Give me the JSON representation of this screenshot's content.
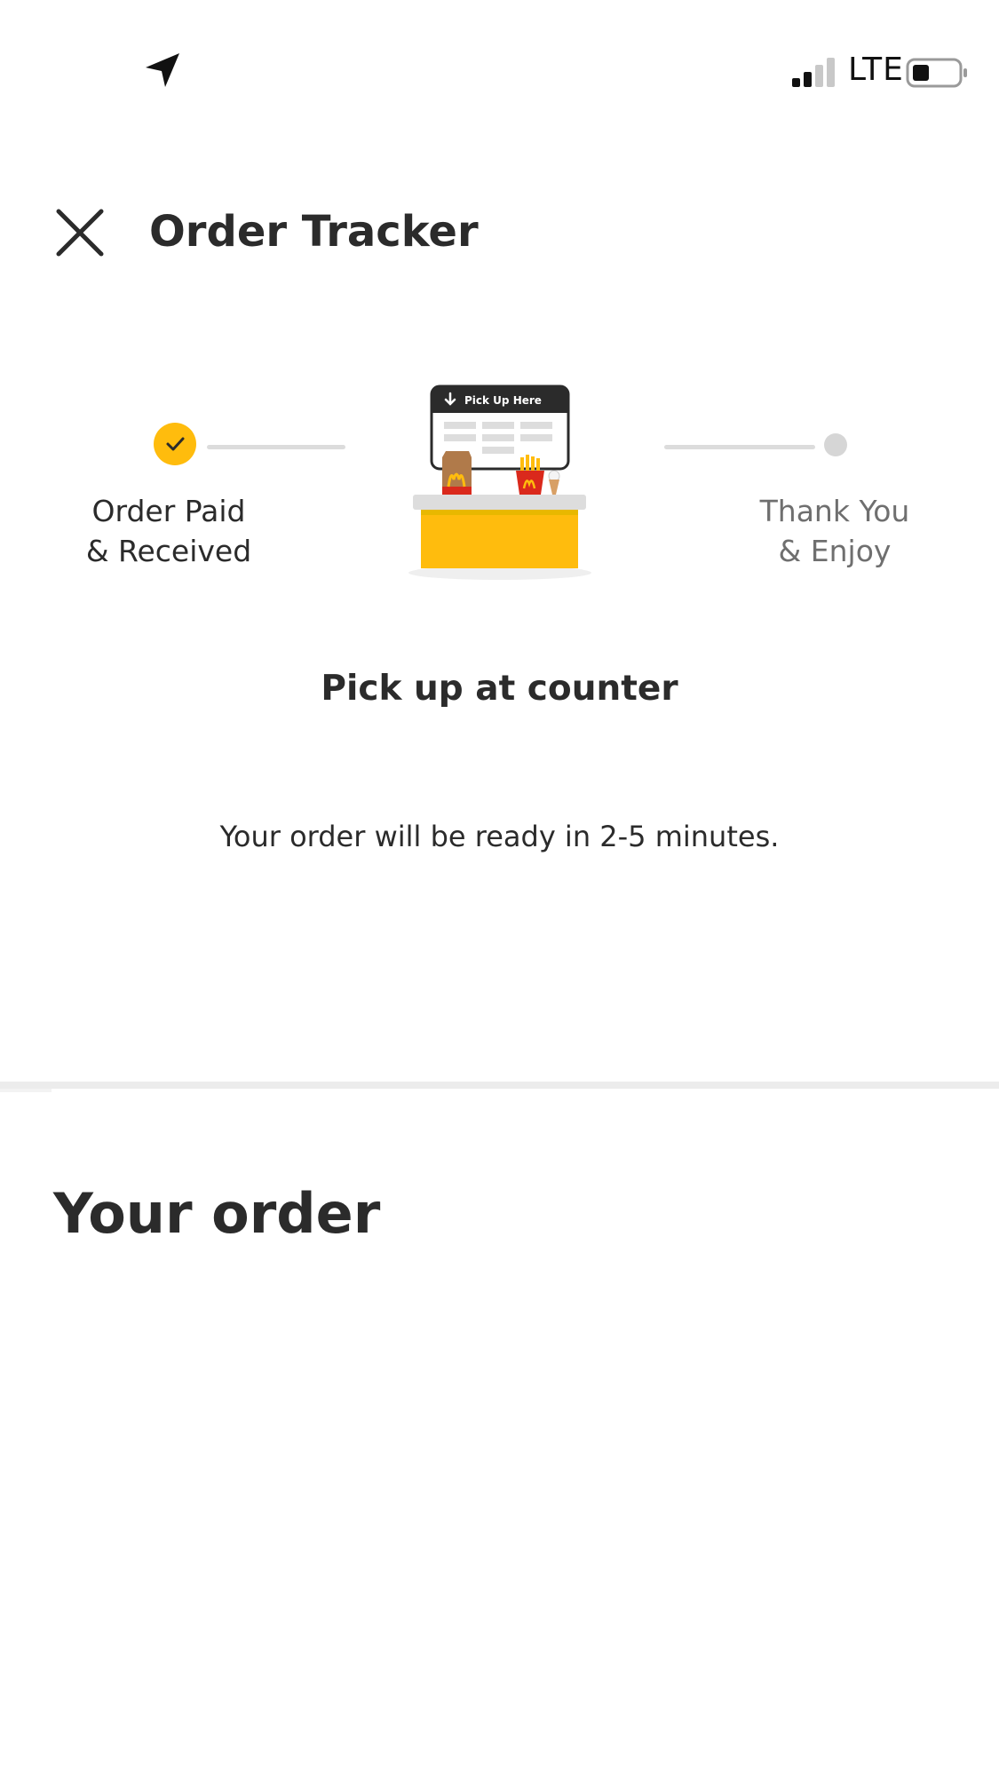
{
  "status_bar": {
    "network": "LTE",
    "icons": [
      "location-arrow-icon",
      "signal-icon",
      "battery-icon"
    ]
  },
  "header": {
    "title": "Order Tracker",
    "close_icon": "close-icon"
  },
  "tracker": {
    "steps": [
      {
        "line1": "Order Paid",
        "line2": "& Received",
        "state": "done"
      },
      {
        "line1": "Thank You",
        "line2": "& Enjoy",
        "state": "pending"
      }
    ],
    "illustration_sign": "Pick Up Here",
    "status_title": "Pick up at counter",
    "status_message": "Your order will be ready in 2-5 minutes."
  },
  "order": {
    "heading": "Your order"
  },
  "colors": {
    "accent_yellow": "#ffbc0d",
    "mcd_red": "#da291c",
    "text_dark": "#2b2b2b",
    "text_muted": "#6f6f6f",
    "line_gray": "#dcdcdc"
  }
}
